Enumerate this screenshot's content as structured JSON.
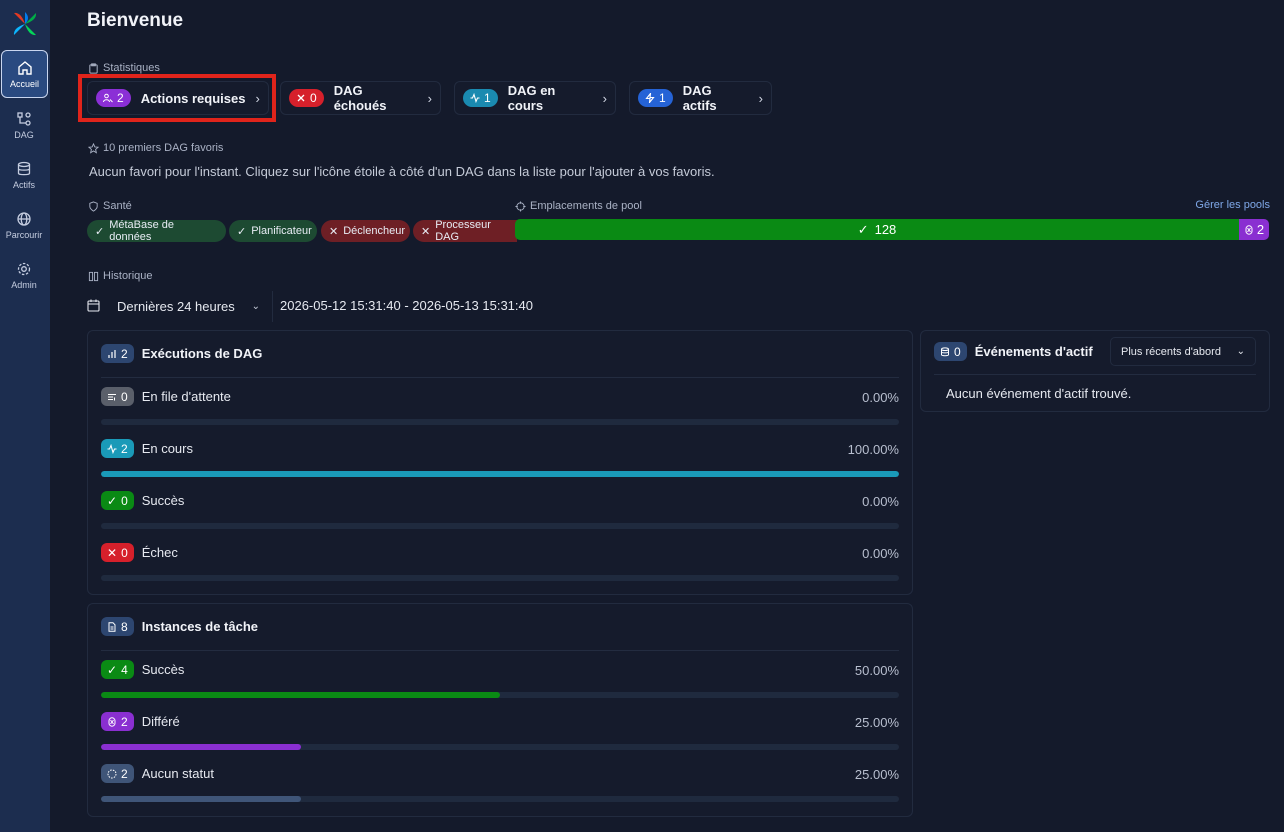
{
  "nav": {
    "items": [
      {
        "label": "Accueil"
      },
      {
        "label": "DAG"
      },
      {
        "label": "Actifs"
      },
      {
        "label": "Parcourir"
      },
      {
        "label": "Admin"
      }
    ]
  },
  "page": {
    "title": "Bienvenue"
  },
  "stats": {
    "label": "Statistiques",
    "cards": [
      {
        "count": "2",
        "label": "Actions requises",
        "color": "#8b2fd6"
      },
      {
        "count": "0",
        "label": "DAG échoués",
        "color": "#d6202b"
      },
      {
        "count": "1",
        "label": "DAG en cours",
        "color": "#1a8ab0"
      },
      {
        "count": "1",
        "label": "DAG actifs",
        "color": "#2563d6"
      }
    ]
  },
  "favorites": {
    "label": "10 premiers DAG favoris",
    "empty_text": "Aucun favori pour l'instant. Cliquez sur l'icône étoile à côté d'un DAG dans la liste pour l'ajouter à vos favoris."
  },
  "health": {
    "label": "Santé",
    "items": [
      {
        "label": "MétaBase de données",
        "status": "ok"
      },
      {
        "label": "Planificateur",
        "status": "ok"
      },
      {
        "label": "Déclencheur",
        "status": "bad"
      },
      {
        "label": "Processeur DAG",
        "status": "bad"
      }
    ]
  },
  "pool": {
    "label": "Emplacements de pool",
    "manage_label": "Gérer les pools",
    "running": "128",
    "deferred": "2",
    "running_color": "#0a8a14",
    "deferred_color": "#8a2fd1"
  },
  "history": {
    "label": "Historique",
    "range_select": "Dernières 24 heures",
    "date_range": "2026-05-12 15:31:40 - 2026-05-13 15:31:40"
  },
  "dag_runs": {
    "title": "Exécutions de DAG",
    "count": "2",
    "rows": [
      {
        "count": "0",
        "label": "En file d'attente",
        "pct": "0.00%",
        "fraction": 0.0,
        "color": "#5a5f6a"
      },
      {
        "count": "2",
        "label": "En cours",
        "pct": "100.00%",
        "fraction": 1.0,
        "color": "#1a9ab8"
      },
      {
        "count": "0",
        "label": "Succès",
        "pct": "0.00%",
        "fraction": 0.0,
        "color": "#0a8a14"
      },
      {
        "count": "0",
        "label": "Échec",
        "pct": "0.00%",
        "fraction": 0.0,
        "color": "#d6202b"
      }
    ]
  },
  "task_instances": {
    "title": "Instances de tâche",
    "count": "8",
    "rows": [
      {
        "count": "4",
        "label": "Succès",
        "pct": "50.00%",
        "fraction": 0.5,
        "color": "#0a8a14"
      },
      {
        "count": "2",
        "label": "Différé",
        "pct": "25.00%",
        "fraction": 0.25,
        "color": "#8a2fd1"
      },
      {
        "count": "2",
        "label": "Aucun statut",
        "pct": "25.00%",
        "fraction": 0.25,
        "color": "#3f5578"
      }
    ]
  },
  "asset_events": {
    "title": "Événements d'actif",
    "count": "0",
    "sort": "Plus récents d'abord",
    "empty_text": "Aucun événement d'actif trouvé."
  }
}
